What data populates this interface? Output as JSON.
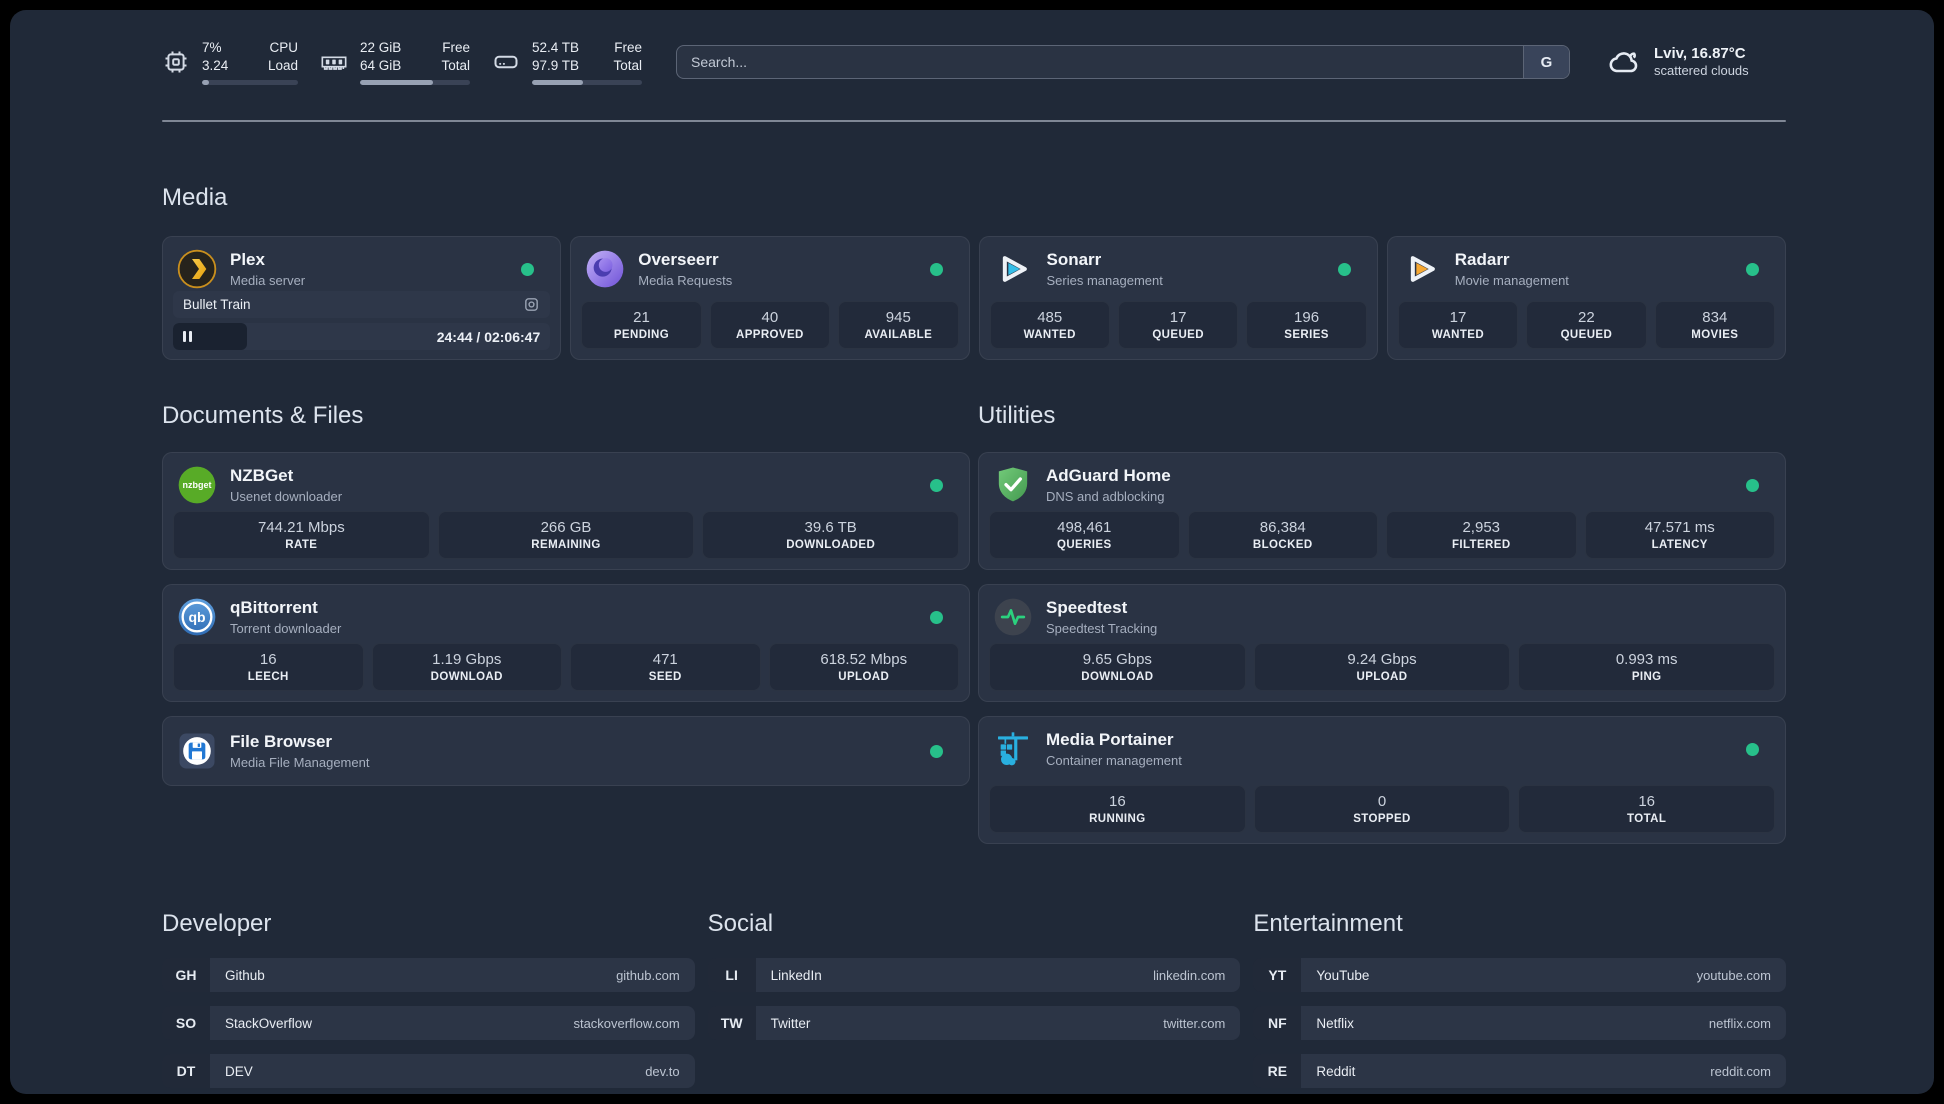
{
  "header": {
    "cpu": {
      "icon": "cpu-icon",
      "value_top": "7%",
      "value_bottom": "3.24",
      "label_top": "CPU",
      "label_bottom": "Load",
      "progress_pct": 7
    },
    "ram": {
      "icon": "ram-icon",
      "value_top": "22 GiB",
      "value_bottom": "64 GiB",
      "label_top": "Free",
      "label_bottom": "Total",
      "progress_pct": 66
    },
    "disk": {
      "icon": "disk-icon",
      "value_top": "52.4 TB",
      "value_bottom": "97.9 TB",
      "label_top": "Free",
      "label_bottom": "Total",
      "progress_pct": 46
    },
    "search": {
      "placeholder": "Search...",
      "button_label": "G"
    },
    "weather": {
      "icon": "cloud-icon",
      "location": "Lviv, 16.87°C",
      "condition": "scattered clouds"
    }
  },
  "colors": {
    "status_online": "#27c08a",
    "plex_amber": "#e5a00d",
    "sonarr_cyan": "#35bee8",
    "radarr_orange": "#f7a832",
    "nzbget_green": "#58ab27",
    "qbittorrent_blue": "#4a86c9",
    "adguard_green": "#5cb85f",
    "speedtest_green": "#2bd17e",
    "portainer_cyan": "#29b0e0"
  },
  "sections": {
    "media": {
      "title": "Media",
      "cards": [
        {
          "icon": "plex-icon",
          "name": "Plex",
          "subtitle": "Media server",
          "status": "online",
          "player": {
            "track": "Bullet Train",
            "time_display": "24:44 / 02:06:47",
            "progress_pct": 19.5,
            "state": "paused"
          }
        },
        {
          "icon": "overseerr-icon",
          "name": "Overseerr",
          "subtitle": "Media Requests",
          "status": "online",
          "stats": [
            {
              "value": "21",
              "label": "PENDING"
            },
            {
              "value": "40",
              "label": "APPROVED"
            },
            {
              "value": "945",
              "label": "AVAILABLE"
            }
          ]
        },
        {
          "icon": "sonarr-icon",
          "name": "Sonarr",
          "subtitle": "Series management",
          "status": "online",
          "stats": [
            {
              "value": "485",
              "label": "WANTED"
            },
            {
              "value": "17",
              "label": "QUEUED"
            },
            {
              "value": "196",
              "label": "SERIES"
            }
          ]
        },
        {
          "icon": "radarr-icon",
          "name": "Radarr",
          "subtitle": "Movie management",
          "status": "online",
          "stats": [
            {
              "value": "17",
              "label": "WANTED"
            },
            {
              "value": "22",
              "label": "QUEUED"
            },
            {
              "value": "834",
              "label": "MOVIES"
            }
          ]
        }
      ]
    },
    "documents": {
      "title": "Documents & Files",
      "cards": [
        {
          "icon": "nzbget-icon",
          "name": "NZBGet",
          "subtitle": "Usenet downloader",
          "status": "online",
          "stats": [
            {
              "value": "744.21 Mbps",
              "label": "RATE"
            },
            {
              "value": "266 GB",
              "label": "REMAINING"
            },
            {
              "value": "39.6 TB",
              "label": "DOWNLOADED"
            }
          ]
        },
        {
          "icon": "qbittorrent-icon",
          "name": "qBittorrent",
          "subtitle": "Torrent downloader",
          "status": "online",
          "stats": [
            {
              "value": "16",
              "label": "LEECH"
            },
            {
              "value": "1.19 Gbps",
              "label": "DOWNLOAD"
            },
            {
              "value": "471",
              "label": "SEED"
            },
            {
              "value": "618.52 Mbps",
              "label": "UPLOAD"
            }
          ]
        },
        {
          "icon": "filebrowser-icon",
          "name": "File Browser",
          "subtitle": "Media File Management",
          "status": "online"
        }
      ]
    },
    "utilities": {
      "title": "Utilities",
      "cards": [
        {
          "icon": "adguard-icon",
          "name": "AdGuard Home",
          "subtitle": "DNS and adblocking",
          "status": "online",
          "stats": [
            {
              "value": "498,461",
              "label": "QUERIES"
            },
            {
              "value": "86,384",
              "label": "BLOCKED"
            },
            {
              "value": "2,953",
              "label": "FILTERED"
            },
            {
              "value": "47.571 ms",
              "label": "LATENCY"
            }
          ]
        },
        {
          "icon": "speedtest-icon",
          "name": "Speedtest",
          "subtitle": "Speedtest Tracking",
          "status": "none",
          "stats": [
            {
              "value": "9.65 Gbps",
              "label": "DOWNLOAD"
            },
            {
              "value": "9.24 Gbps",
              "label": "UPLOAD"
            },
            {
              "value": "0.993 ms",
              "label": "PING"
            }
          ]
        },
        {
          "icon": "portainer-icon",
          "name": "Media Portainer",
          "subtitle": "Container management",
          "status": "online",
          "stats": [
            {
              "value": "16",
              "label": "RUNNING"
            },
            {
              "value": "0",
              "label": "STOPPED"
            },
            {
              "value": "16",
              "label": "TOTAL"
            }
          ]
        }
      ]
    }
  },
  "links": [
    {
      "title": "Developer",
      "items": [
        {
          "abbr": "GH",
          "name": "Github",
          "url": "github.com"
        },
        {
          "abbr": "SO",
          "name": "StackOverflow",
          "url": "stackoverflow.com"
        },
        {
          "abbr": "DT",
          "name": "DEV",
          "url": "dev.to"
        }
      ]
    },
    {
      "title": "Social",
      "items": [
        {
          "abbr": "LI",
          "name": "LinkedIn",
          "url": "linkedin.com"
        },
        {
          "abbr": "TW",
          "name": "Twitter",
          "url": "twitter.com"
        }
      ]
    },
    {
      "title": "Entertainment",
      "items": [
        {
          "abbr": "YT",
          "name": "YouTube",
          "url": "youtube.com"
        },
        {
          "abbr": "NF",
          "name": "Netflix",
          "url": "netflix.com"
        },
        {
          "abbr": "RE",
          "name": "Reddit",
          "url": "reddit.com"
        }
      ]
    }
  ]
}
